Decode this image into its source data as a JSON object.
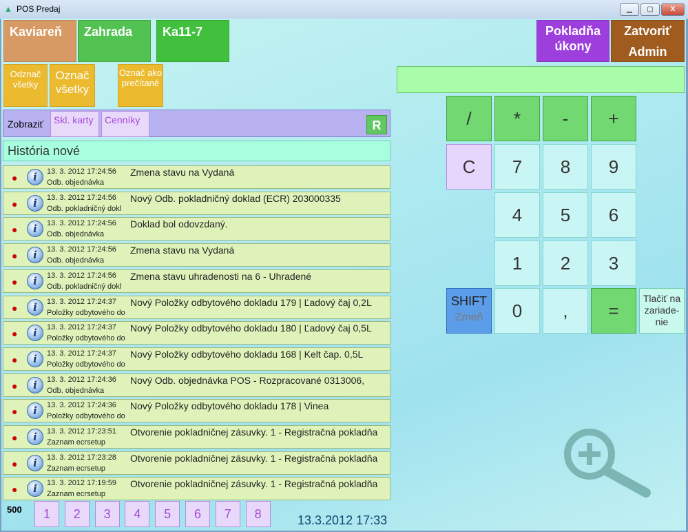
{
  "window": {
    "title": "POS Predaj",
    "minimize": "▁",
    "maximize": "▢",
    "close": "X"
  },
  "tabs": {
    "kaviaren": "Kaviareň",
    "zahrada": "Zahrada",
    "ka11": "Ka11-7",
    "pokladna": "Pokladňa úkony",
    "zatvorit": "Zatvoriť",
    "admin": "Admin"
  },
  "actions": {
    "odznac_vsetky": "Odznač všetky",
    "oznac_vsetky": "Označ všetky",
    "oznac_precitane": "Označ ako prečítané"
  },
  "filter": {
    "label": "Zobraziť",
    "skl_karty": "Skl. karty",
    "cenniky": "Cenníky",
    "refresh": "R"
  },
  "history": {
    "title": "História nové",
    "rows": [
      {
        "ts": "13. 3. 2012 17:24:56",
        "src": "Odb. objednávka",
        "msg": "Zmena stavu na Vydaná"
      },
      {
        "ts": "13. 3. 2012 17:24:56",
        "src": "Odb. pokladničný dokl",
        "msg": "Nový Odb. pokladničný doklad (ECR) 203000335"
      },
      {
        "ts": "13. 3. 2012 17:24:56",
        "src": "Odb. objednávka",
        "msg": "Doklad bol odovzdaný."
      },
      {
        "ts": "13. 3. 2012 17:24:56",
        "src": "Odb. objednávka",
        "msg": "Zmena stavu na Vydaná"
      },
      {
        "ts": "13. 3. 2012 17:24:56",
        "src": "Odb. pokladničný dokl",
        "msg": "Zmena stavu uhradenosti na 6 - Uhradené"
      },
      {
        "ts": "13. 3. 2012 17:24:37",
        "src": "Položky odbytového do",
        "msg": "Nový Položky odbytového dokladu 179 | Ľadový čaj 0,2L"
      },
      {
        "ts": "13. 3. 2012 17:24:37",
        "src": "Položky odbytového do",
        "msg": "Nový Položky odbytového dokladu 180 | Ľadový čaj 0,5L"
      },
      {
        "ts": "13. 3. 2012 17:24:37",
        "src": "Položky odbytového do",
        "msg": "Nový Položky odbytového dokladu 168 | Kelt čap. 0,5L"
      },
      {
        "ts": "13. 3. 2012 17:24:36",
        "src": "Odb. objednávka",
        "msg": "Nový Odb. objednávka POS - Rozpracované 0313006,"
      },
      {
        "ts": "13. 3. 2012 17:24:36",
        "src": "Položky odbytového do",
        "msg": "Nový Položky odbytového dokladu 178 | Vinea"
      },
      {
        "ts": "13. 3. 2012 17:23:51",
        "src": "Zaznam ecrsetup",
        "msg": "Otvorenie pokladničnej zásuvky. 1 - Registračná pokladňa"
      },
      {
        "ts": "13. 3. 2012 17:23:28",
        "src": "Zaznam ecrsetup",
        "msg": "Otvorenie pokladničnej zásuvky. 1 - Registračná pokladňa"
      },
      {
        "ts": "13. 3. 2012 17:19:59",
        "src": "Zaznam ecrsetup",
        "msg": "Otvorenie pokladničnej zásuvky. 1 - Registračná pokladňa"
      }
    ]
  },
  "pager": {
    "count": "500",
    "pages": [
      "1",
      "2",
      "3",
      "4",
      "5",
      "6",
      "7",
      "8"
    ]
  },
  "datetime": "13.3.2012 17:33",
  "display": {
    "value": ""
  },
  "keypad": {
    "div": "/",
    "mul": "*",
    "minus": "-",
    "plus": "+",
    "clear": "C",
    "k7": "7",
    "k8": "8",
    "k9": "9",
    "k4": "4",
    "k5": "5",
    "k6": "6",
    "k1": "1",
    "k2": "2",
    "k3": "3",
    "shift": "SHIFT",
    "shift_sub": "Zmeň",
    "k0": "0",
    "comma": ",",
    "equals": "=",
    "print": "Tlačiť na zariade-nie"
  },
  "icons": {
    "info": "info-icon",
    "zoom": "zoom-in-icon",
    "bullet": "bullet-icon"
  }
}
